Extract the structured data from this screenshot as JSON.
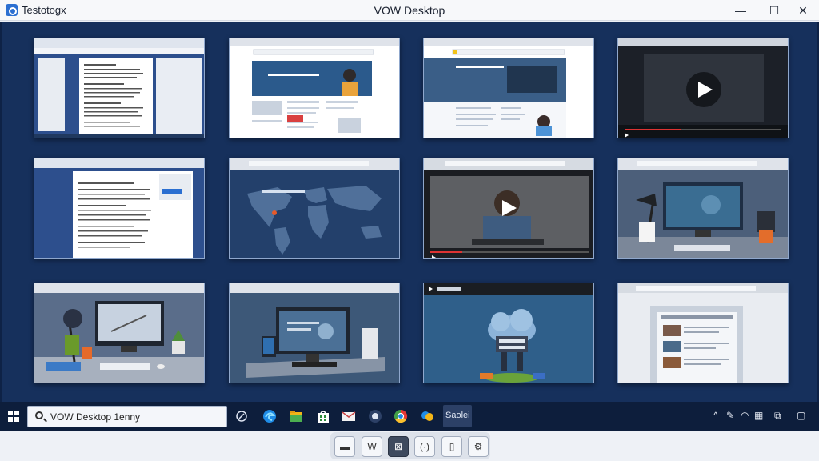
{
  "window": {
    "app_name": "Testotogx",
    "title": "VOW Desktop",
    "minimize_glyph": "—",
    "maximize_glyph": "☐",
    "close_glyph": "✕"
  },
  "thumbnails": [
    {
      "name": "word-document-window",
      "icon": "document-icon"
    },
    {
      "name": "news-website-window",
      "icon": "browser-icon"
    },
    {
      "name": "article-website-window",
      "icon": "browser-icon"
    },
    {
      "name": "video-player-window",
      "icon": "play-icon"
    },
    {
      "name": "document-editor-window",
      "icon": "document-icon"
    },
    {
      "name": "world-map-window",
      "icon": "map-icon"
    },
    {
      "name": "video-lecture-window",
      "icon": "play-icon"
    },
    {
      "name": "desk-scene-window",
      "icon": "image-icon"
    },
    {
      "name": "office-desk-window",
      "icon": "image-icon"
    },
    {
      "name": "computer-desk-window",
      "icon": "image-icon"
    },
    {
      "name": "cloud-robot-window",
      "icon": "image-icon"
    },
    {
      "name": "gallery-browser-window",
      "icon": "browser-icon"
    }
  ],
  "taskbar": {
    "search_text": "VOW Desktop 1enny",
    "active_app_label": "Saolei",
    "colors": {
      "edge": "#1f8ce6",
      "files": "#f2b518",
      "chrome_red": "#e53935",
      "chrome_green": "#43a047",
      "chrome_yellow": "#fbc02d"
    },
    "tray": {
      "chevron": "^",
      "pen": "✎",
      "wifi": "◠",
      "grid": "▦",
      "window": "⧉",
      "notification": "▢"
    }
  },
  "dock": {
    "items": [
      {
        "name": "dock-screen-button",
        "glyph": "▬"
      },
      {
        "name": "dock-tools-button",
        "glyph": "W"
      },
      {
        "name": "dock-capture-button",
        "glyph": "⊠"
      },
      {
        "name": "dock-audio-button",
        "glyph": "(·)"
      },
      {
        "name": "dock-device-button",
        "glyph": "▯"
      },
      {
        "name": "dock-settings-button",
        "glyph": "⚙"
      }
    ]
  }
}
